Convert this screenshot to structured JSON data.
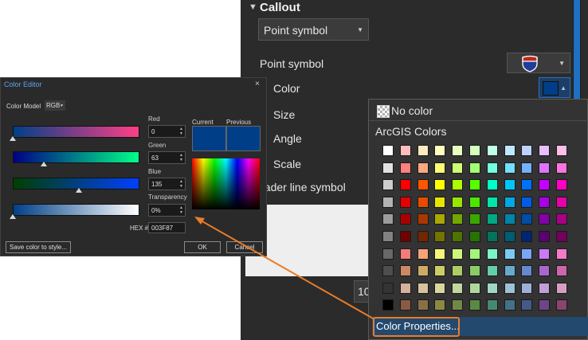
{
  "pane": {
    "callout_title": "Callout",
    "point_dropdown": "Point symbol",
    "point_symbol_label": "Point symbol",
    "color_label": "Color",
    "size_label": "Size",
    "angle_label": "Angle",
    "scale_label": "Scale",
    "leader_label": "eader line symbol",
    "number_field": "10"
  },
  "picker": {
    "no_color": "No color",
    "palette_title": "ArcGIS Colors",
    "color_properties": "Color Properties...",
    "palette": [
      [
        "#FFFFFF",
        "#FFBEBE",
        "#FFEBBE",
        "#FFFFBE",
        "#E9FFBE",
        "#D3FFBE",
        "#BEFFE8",
        "#BEE8FF",
        "#BED2FF",
        "#E8BEFF",
        "#FFBEE8"
      ],
      [
        "#E1E1E1",
        "#FF7F7F",
        "#FFA77F",
        "#FFFF73",
        "#D1FF73",
        "#A3FF73",
        "#73FFDF",
        "#73DFFF",
        "#73B2FF",
        "#DF73FF",
        "#FF73DF"
      ],
      [
        "#CCCCCC",
        "#FF0000",
        "#FF5500",
        "#FFFF00",
        "#AAFF00",
        "#55FF00",
        "#00FFC5",
        "#00C5FF",
        "#0070FF",
        "#C500FF",
        "#FF00C5"
      ],
      [
        "#B2B2B2",
        "#E60000",
        "#E64C00",
        "#E6E600",
        "#98E600",
        "#4CE600",
        "#00E6A9",
        "#00A9E6",
        "#005CE6",
        "#A900E6",
        "#E600A9"
      ],
      [
        "#9C9C9C",
        "#A80000",
        "#A83800",
        "#A8A800",
        "#70A800",
        "#38A800",
        "#00A884",
        "#0084A8",
        "#004DA8",
        "#8400A8",
        "#A80084"
      ],
      [
        "#828282",
        "#730000",
        "#732600",
        "#737300",
        "#4C7300",
        "#267300",
        "#00735C",
        "#005C73",
        "#002673",
        "#5C0073",
        "#73005C"
      ],
      [
        "#686868",
        "#F57A7A",
        "#F5A27A",
        "#F5F57A",
        "#CDF57A",
        "#A5F57A",
        "#7AF5CA",
        "#7ACAF5",
        "#7AA5F5",
        "#CA7AF5",
        "#F57ACA"
      ],
      [
        "#4E4E4E",
        "#CD8966",
        "#CDAA66",
        "#CDCD66",
        "#ABCD66",
        "#89CD66",
        "#66CDAB",
        "#66ABCD",
        "#6689CD",
        "#AB66CD",
        "#CD66AB"
      ],
      [
        "#343434",
        "#D7B09E",
        "#D7C29E",
        "#D7D79E",
        "#C2D79E",
        "#B0D79E",
        "#9ED7C2",
        "#9EC2D7",
        "#9EB0D7",
        "#C29ED7",
        "#D79EC2"
      ],
      [
        "#000000",
        "#895A44",
        "#897044",
        "#898944",
        "#708944",
        "#5A8944",
        "#448970",
        "#447089",
        "#445A89",
        "#704489",
        "#894470"
      ]
    ]
  },
  "editor": {
    "title": "Color Editor",
    "close": "×",
    "model_label": "Color Model",
    "model_value": "RGB",
    "red_label": "Red",
    "red_value": "0",
    "green_label": "Green",
    "green_value": "63",
    "blue_label": "Blue",
    "blue_value": "135",
    "transparency_label": "Transparency",
    "transparency_value": "0%",
    "hex_label": "HEX #",
    "hex_value": "003F87",
    "current_label": "Current",
    "previous_label": "Previous",
    "save_button": "Save color to style...",
    "ok_button": "OK",
    "cancel_button": "Cancel",
    "current_color": "#003F87",
    "previous_color": "#003F87"
  },
  "colors": {
    "accent": "#1f6fc5",
    "callout_arrow": "#e87d2a"
  }
}
